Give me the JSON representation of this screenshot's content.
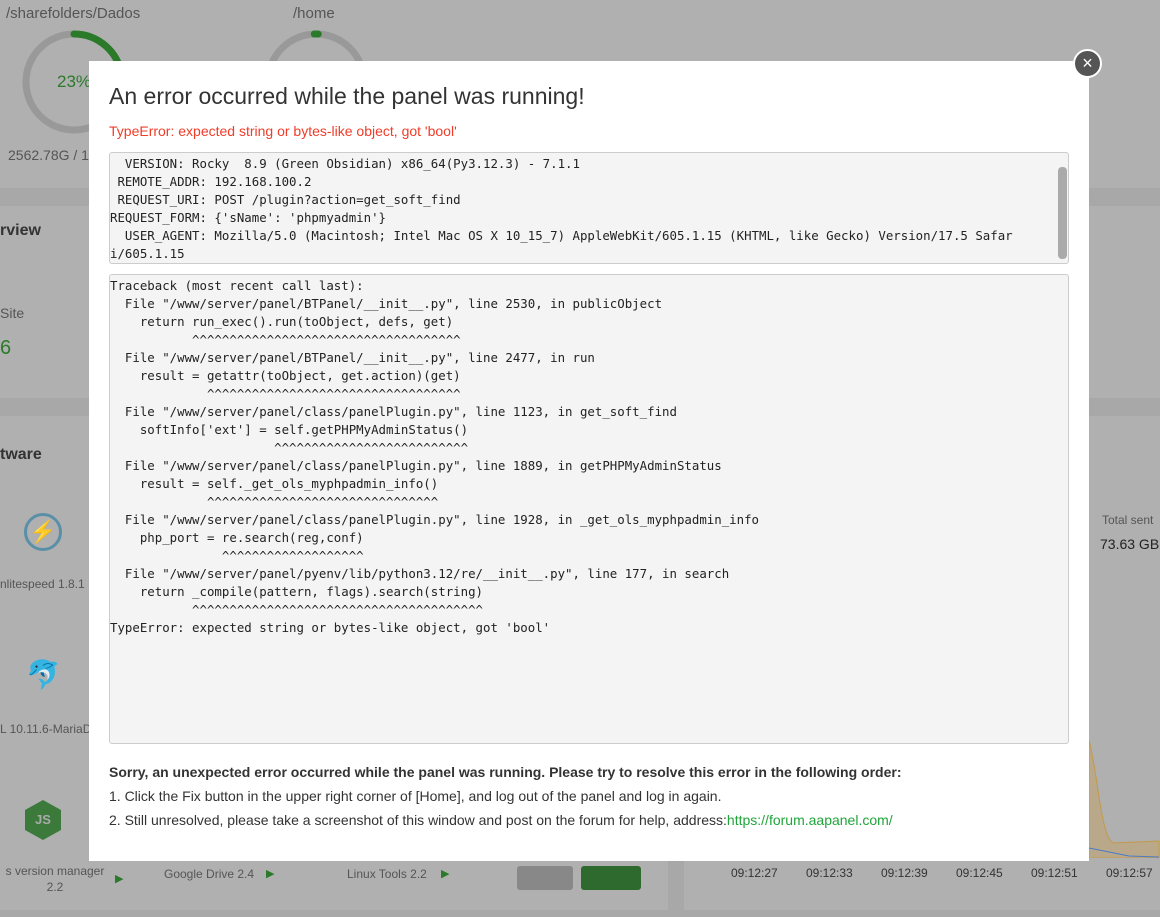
{
  "background": {
    "disks": [
      {
        "path": "/sharefolders/Dados",
        "percent_label": "23%",
        "percent": 23,
        "size": "2562.78G / 1"
      },
      {
        "path": "/home",
        "percent": 2
      }
    ],
    "overview_heading": "rview",
    "site_label": "Site",
    "site_count": "6",
    "software_heading": "tware",
    "software": [
      {
        "name": "nlitespeed 1.8.1"
      },
      {
        "name": "L 10.11.6-MariaD"
      },
      {
        "name": "s version manager 2.2"
      },
      {
        "name": "Google Drive 2.4"
      },
      {
        "name": "Linux Tools 2.2"
      }
    ],
    "total_sent_label": "Total sent",
    "total_sent_value": "73.63 GB",
    "chart_times": [
      "09:12:27",
      "09:12:33",
      "09:12:39",
      "09:12:45",
      "09:12:51",
      "09:12:57"
    ]
  },
  "modal": {
    "title": "An error occurred while the panel was running!",
    "error": "TypeError: expected string or bytes-like object, got 'bool'",
    "env": "  VERSION: Rocky  8.9 (Green Obsidian) x86_64(Py3.12.3) - 7.1.1\n REMOTE_ADDR: 192.168.100.2\n REQUEST_URI: POST /plugin?action=get_soft_find\nREQUEST_FORM: {'sName': 'phpmyadmin'}\n  USER_AGENT: Mozilla/5.0 (Macintosh; Intel Mac OS X 10_15_7) AppleWebKit/605.1.15 (KHTML, like Gecko) Version/17.5 Safar\ni/605.1.15",
    "traceback": "Traceback (most recent call last):\n  File \"/www/server/panel/BTPanel/__init__.py\", line 2530, in publicObject\n    return run_exec().run(toObject, defs, get)\n           ^^^^^^^^^^^^^^^^^^^^^^^^^^^^^^^^^^^^\n  File \"/www/server/panel/BTPanel/__init__.py\", line 2477, in run\n    result = getattr(toObject, get.action)(get)\n             ^^^^^^^^^^^^^^^^^^^^^^^^^^^^^^^^^^\n  File \"/www/server/panel/class/panelPlugin.py\", line 1123, in get_soft_find\n    softInfo['ext'] = self.getPHPMyAdminStatus()\n                      ^^^^^^^^^^^^^^^^^^^^^^^^^^\n  File \"/www/server/panel/class/panelPlugin.py\", line 1889, in getPHPMyAdminStatus\n    result = self._get_ols_myphpadmin_info()\n             ^^^^^^^^^^^^^^^^^^^^^^^^^^^^^^^\n  File \"/www/server/panel/class/panelPlugin.py\", line 1928, in _get_ols_myphpadmin_info\n    php_port = re.search(reg,conf)\n               ^^^^^^^^^^^^^^^^^^^\n  File \"/www/server/panel/pyenv/lib/python3.12/re/__init__.py\", line 177, in search\n    return _compile(pattern, flags).search(string)\n           ^^^^^^^^^^^^^^^^^^^^^^^^^^^^^^^^^^^^^^^\nTypeError: expected string or bytes-like object, got 'bool'",
    "help_title": "Sorry, an unexpected error occurred while the panel was running. Please try to resolve this error in the following order:",
    "step1": "1. Click the Fix button in the upper right corner of [Home], and log out of the panel and log in again.",
    "step2": "2. Still unresolved, please take a screenshot of this window and post on the forum for help, address:",
    "forum_link": "https://forum.aapanel.com/",
    "close_icon": "×"
  },
  "colors": {
    "accent": "#20a53a",
    "error": "#f03c28",
    "overlay": "#a8a8a8"
  }
}
